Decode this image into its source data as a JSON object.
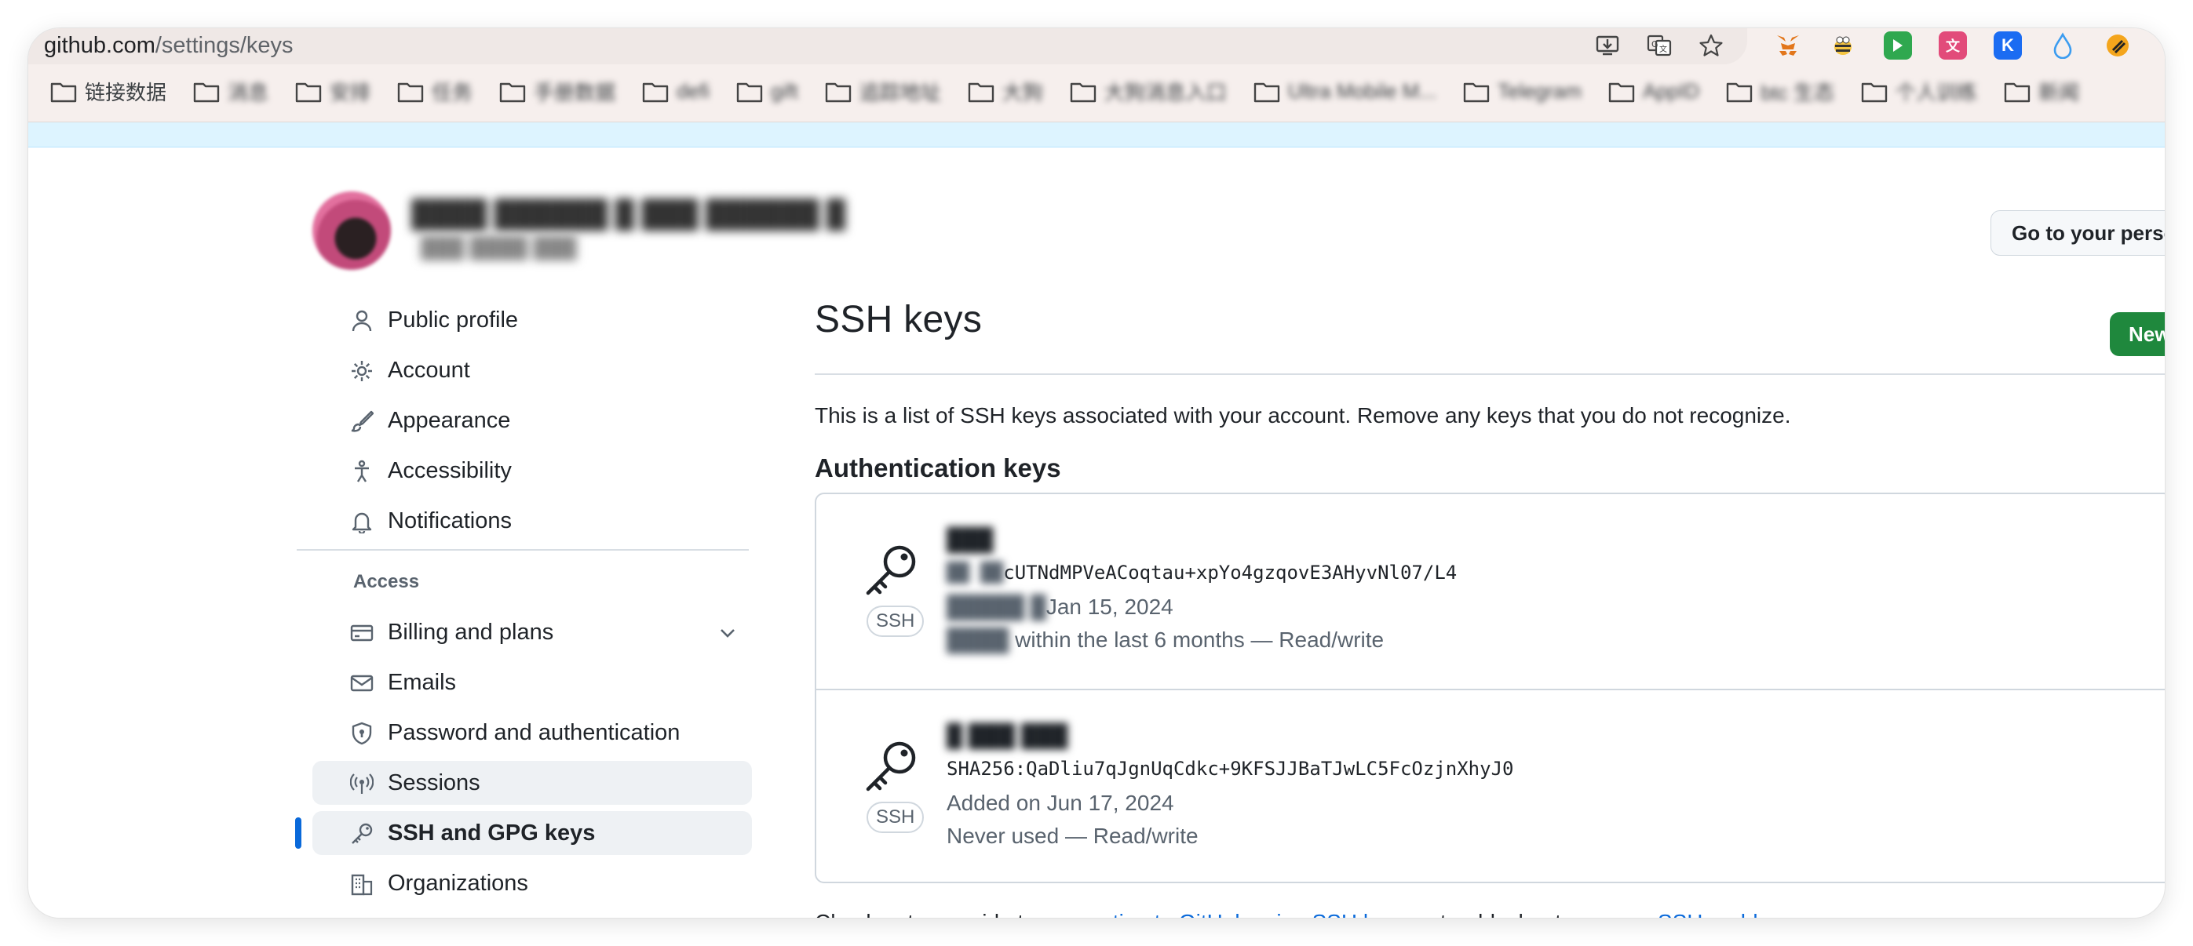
{
  "browser": {
    "url_host": "github.com",
    "url_path": "/settings/keys",
    "bookmarks": [
      {
        "label": "链接数据"
      },
      {
        "label": "消息"
      },
      {
        "label": "安排"
      },
      {
        "label": "任务"
      },
      {
        "label": "手册数据"
      },
      {
        "label": "defi"
      },
      {
        "label": "gift"
      },
      {
        "label": "追踪地址"
      },
      {
        "label": "大狗"
      },
      {
        "label": "大狗消息入口"
      },
      {
        "label": "Ultra Mobile M..."
      },
      {
        "label": "Telegram"
      },
      {
        "label": "AppID"
      },
      {
        "label": "btc 生态"
      },
      {
        "label": "个人训练"
      },
      {
        "label": "新闻"
      }
    ]
  },
  "header": {
    "user_name": "████ ██████ █ ███ ██████ █",
    "user_subtitle": "███ ████ ███",
    "profile_button": "Go to your personal profile"
  },
  "sidebar": {
    "items_top": [
      {
        "label": "Public profile",
        "icon": "person-icon"
      },
      {
        "label": "Account",
        "icon": "gear-icon"
      },
      {
        "label": "Appearance",
        "icon": "paintbrush-icon"
      },
      {
        "label": "Accessibility",
        "icon": "accessibility-icon"
      },
      {
        "label": "Notifications",
        "icon": "bell-icon"
      }
    ],
    "access_heading": "Access",
    "items_access": [
      {
        "label": "Billing and plans",
        "icon": "credit-card-icon"
      },
      {
        "label": "Emails",
        "icon": "mail-icon"
      },
      {
        "label": "Password and authentication",
        "icon": "shield-lock-icon"
      },
      {
        "label": "Sessions",
        "icon": "broadcast-icon"
      },
      {
        "label": "SSH and GPG keys",
        "icon": "key-icon"
      },
      {
        "label": "Organizations",
        "icon": "organization-icon"
      }
    ]
  },
  "main": {
    "title": "SSH keys",
    "new_button": "New SSH key",
    "intro": "This is a list of SSH keys associated with your account. Remove any keys that you do not recognize.",
    "section_title": "Authentication keys",
    "keys": [
      {
        "title": "███",
        "fingerprint_hidden": "██ ██",
        "fingerprint_visible": "cUTNdMPVeACoqtau+xpYo4gzqovE3AHyvNl07/L4",
        "added_hidden": "█████ █",
        "added_visible": "Jan 15, 2024",
        "used_hidden": "████",
        "used_visible": "within the last 6 months — Read/write",
        "badge": "SSH"
      },
      {
        "title": "█ ███ ███",
        "fingerprint": "SHA256:QaDliu7qJgnUqCdkc+9KFSJJBaTJwLC5FcOzjnXhyJ0",
        "added": "Added on Jun 17, 2024",
        "used": "Never used — Read/write",
        "badge": "SSH"
      }
    ],
    "footer_prefix": "Check out our guide to ",
    "footer_link1": "connecting to GitHub using SSH keys",
    "footer_mid": " or troubleshoot ",
    "footer_link2": "common SSH problems"
  }
}
